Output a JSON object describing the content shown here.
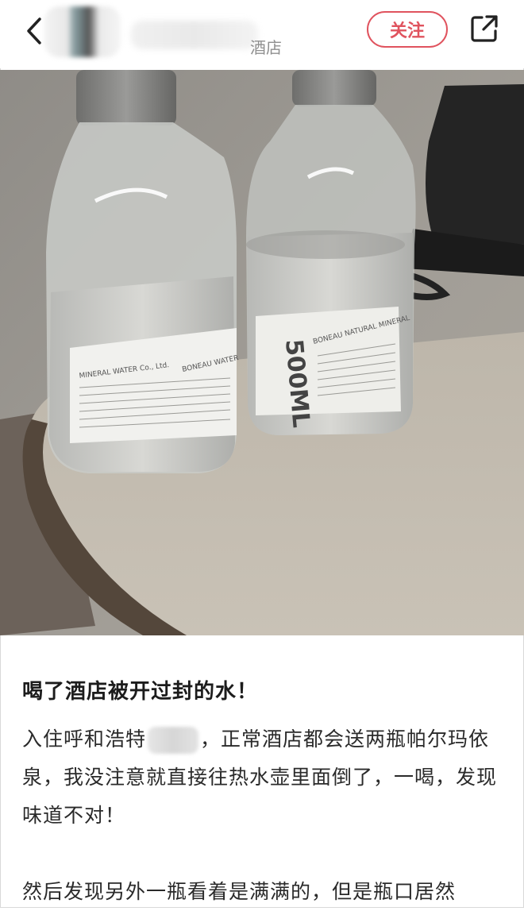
{
  "header": {
    "back_icon": "chevron-left-icon",
    "username_suffix": "酒店",
    "follow_label": "关注",
    "share_icon": "share-external-icon",
    "accent_color": "#e0535e"
  },
  "photo": {
    "bottle_label_left": "MINERAL WATER Co., Ltd.",
    "bottle_label_left2": "BONEAU WATER",
    "bottle_volume": "500ML",
    "bottle_label_right": "BONEAU NATURAL MINERAL"
  },
  "post": {
    "title": "喝了酒店被开过封的水！",
    "p1_a": "入住呼和浩特",
    "p1_b": "，正常酒店都会送两瓶帕尔玛依泉，我没注意就直接往热水壶里面倒了，一喝，发现味道不对！",
    "p2": "然后发现另外一瓶看着是满满的，但是瓶口居然"
  }
}
